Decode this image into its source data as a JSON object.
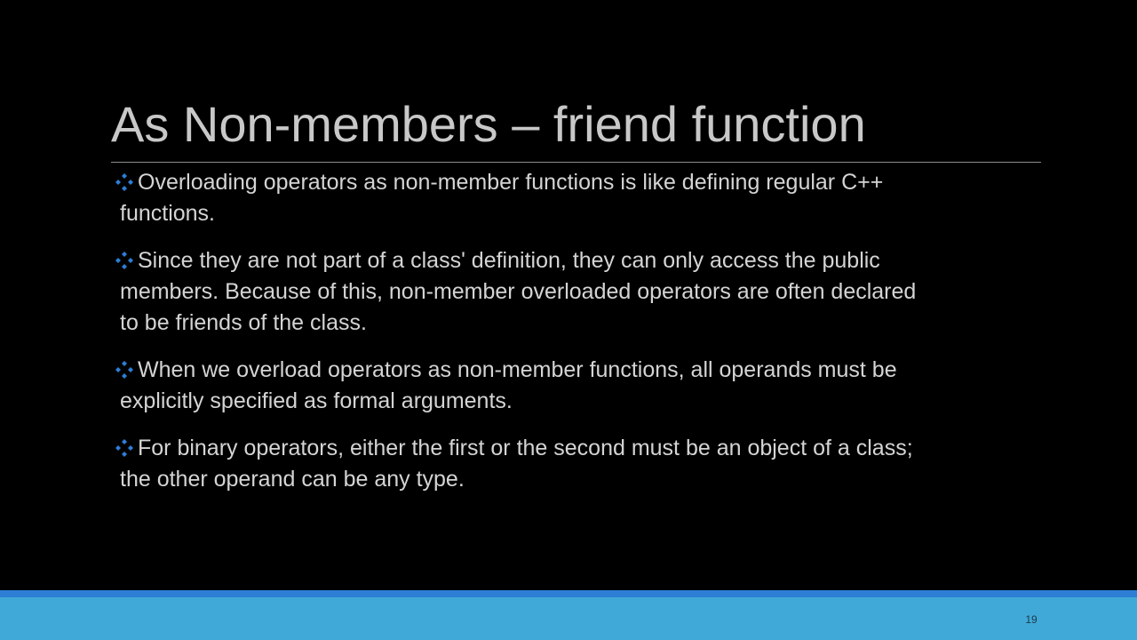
{
  "slide": {
    "title": "As Non-members – friend function",
    "bullets": [
      {
        "icon": "diamond-bullet-icon",
        "text": "Overloading operators as non-member functions is like defining regular C++ functions."
      },
      {
        "icon": "diamond-bullet-icon",
        "text": "Since they are not part of a class' definition, they can only access the public members. Because of this, non-member overloaded operators are often declared to be friends of the class."
      },
      {
        "icon": "diamond-bullet-icon",
        "text": "When we overload operators as non-member functions, all operands must be explicitly specified as formal arguments."
      },
      {
        "icon": "diamond-bullet-icon",
        "text": "For binary operators, either the first or the second must be an object of a class; the other operand can be any type."
      }
    ],
    "page_number": "19"
  },
  "colors": {
    "background": "#000000",
    "title": "#c8c8c8",
    "body_text": "#d4d4d4",
    "bullet_icon": "#2d7fd6",
    "footer_band": "#41a9d8",
    "footer_accent": "#2d7fd6"
  }
}
